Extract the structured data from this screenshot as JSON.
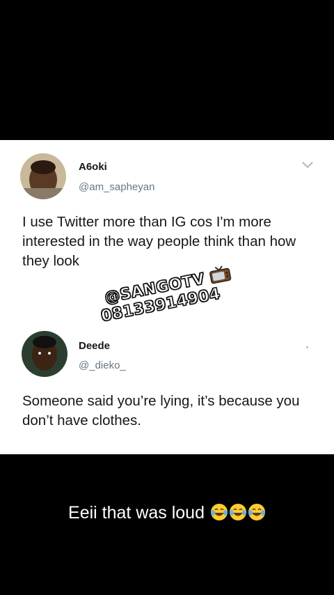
{
  "tweets": [
    {
      "name": "A6oki",
      "handle": "@am_sapheyan",
      "text": "I use Twitter more than IG cos I'm more interested in the way people think than how they look"
    },
    {
      "name": "Deede",
      "handle": "@_dieko_",
      "text": "Someone said you’re lying, it’s because you don’t have clothes."
    }
  ],
  "watermark": {
    "line1": "@SANGOTV",
    "line2": "08133914904"
  },
  "caption": "Eeii that was loud",
  "icons": [
    "chevron-down-icon",
    "tv-icon",
    "tears-of-joy-emoji"
  ]
}
